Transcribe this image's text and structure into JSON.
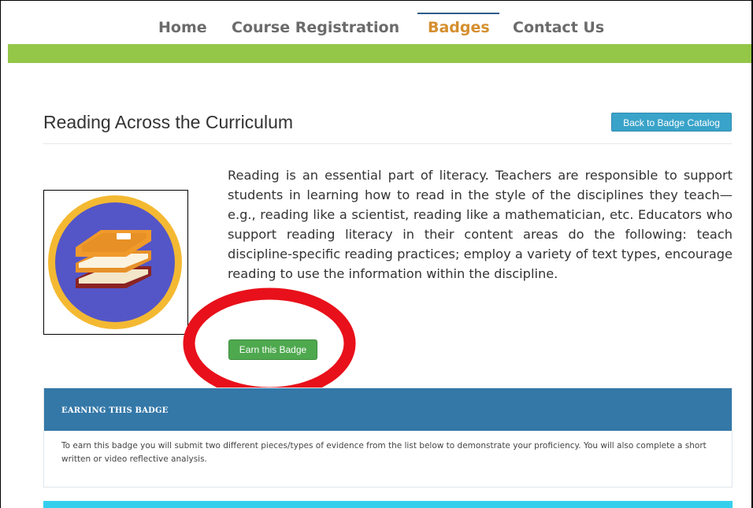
{
  "nav": {
    "items": [
      {
        "label": "Home"
      },
      {
        "label": "Course Registration"
      },
      {
        "label": "Badges"
      },
      {
        "label": "Contact Us"
      }
    ],
    "active_index": 2
  },
  "page": {
    "title": "Reading Across the Curriculum",
    "back_button": "Back to Badge Catalog",
    "description": "Reading is an essential part of literacy. Teachers are responsible to support students in learning how to read in the style of the disciplines they teach—e.g., reading like a scientist, reading like a mathematician, etc. Educators who support reading literacy in their content areas do the following: teach discipline-specific reading practices; employ a variety of text types, encourage reading to use the information within the discipline.",
    "earn_button": "Earn this Badge"
  },
  "earning_panel": {
    "title": "EARNING THIS BADGE",
    "body": "To earn this badge you will submit two different pieces/types of evidence from the list below to demonstrate your proficiency. You will also complete a short written or video reflective analysis."
  },
  "colors": {
    "nav_text": "#6b6b6b",
    "nav_active": "#d58f2e",
    "green_bar": "#94c748",
    "back_button": "#3aa3c9",
    "earn_button": "#4ea84e",
    "panel_header": "#3478a8",
    "cyan_bar": "#35cfee",
    "annotation_ring": "#e8101a"
  },
  "icons": {
    "badge": "book-stack-badge-icon"
  }
}
